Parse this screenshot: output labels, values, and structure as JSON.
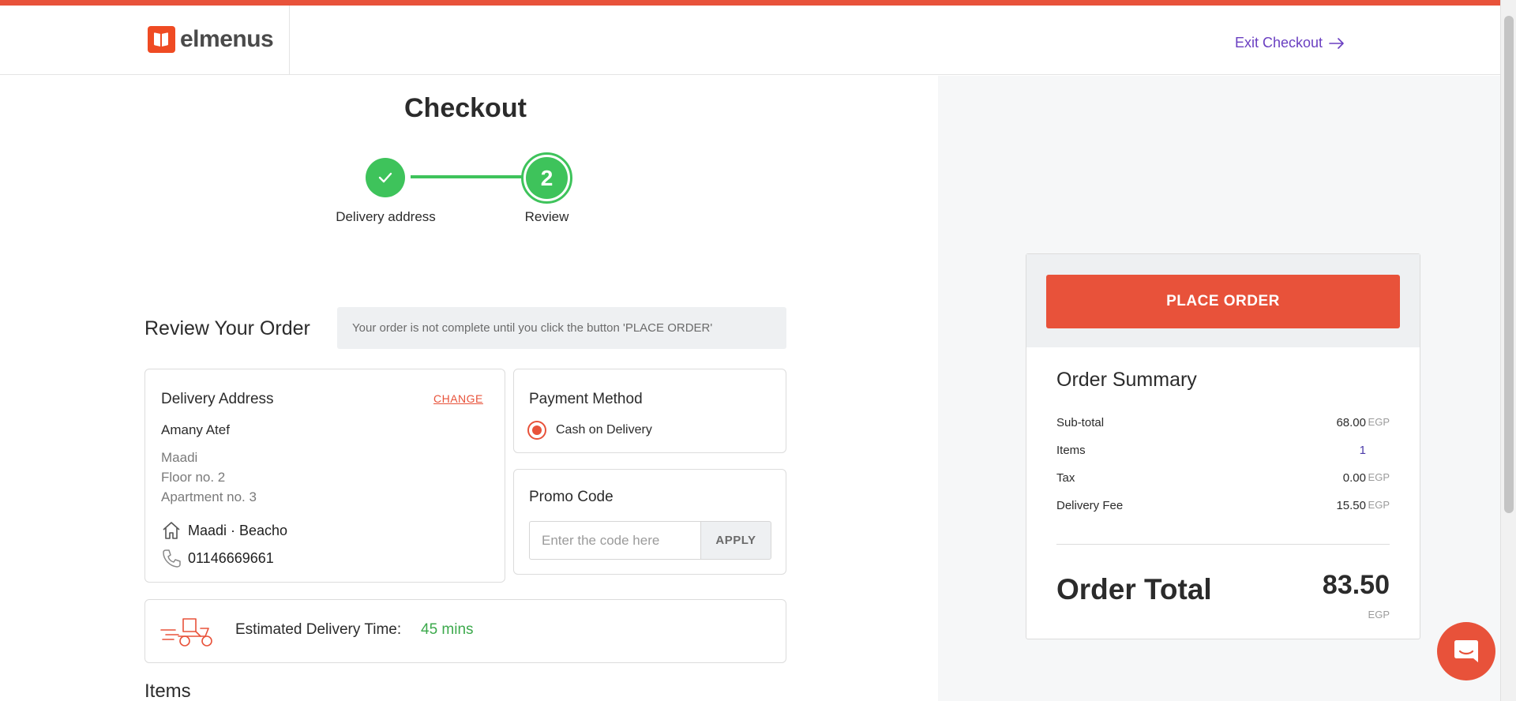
{
  "brand": {
    "name": "elmenus",
    "accent": "#e8523a",
    "success": "#3ec35b"
  },
  "header": {
    "exit_label": "Exit Checkout"
  },
  "checkout": {
    "title": "Checkout",
    "steps": [
      {
        "label": "Delivery address",
        "status": "completed"
      },
      {
        "label": "Review",
        "number": "2",
        "status": "current"
      }
    ]
  },
  "review": {
    "heading": "Review Your Order",
    "notice": "Your order is not complete until you click the button 'PLACE ORDER'"
  },
  "delivery_address": {
    "title": "Delivery Address",
    "change_label": "CHANGE",
    "name": "Amany Atef",
    "lines": [
      "Maadi",
      "Floor no. 2",
      "Apartment no. 3"
    ],
    "area": "Maadi · Beacho",
    "phone": "01146669661"
  },
  "payment": {
    "title": "Payment Method",
    "option": "Cash on Delivery"
  },
  "promo": {
    "title": "Promo Code",
    "placeholder": "Enter the code here",
    "apply_label": "APPLY"
  },
  "eta": {
    "label": "Estimated Delivery Time:",
    "value": "45 mins"
  },
  "items_heading": "Items",
  "summary": {
    "place_order_label": "PLACE ORDER",
    "title": "Order Summary",
    "subtotal_label": "Sub-total",
    "subtotal_value": "68.00",
    "items_label": "Items",
    "items_value": "1",
    "tax_label": "Tax",
    "tax_value": "0.00",
    "delivery_label": "Delivery Fee",
    "delivery_value": "15.50",
    "currency": "EGP",
    "total_label": "Order Total",
    "total_value": "83.50"
  },
  "icons": [
    "check-icon",
    "arrow-right-icon",
    "home-icon",
    "phone-icon",
    "delivery-scooter-icon",
    "chat-icon"
  ]
}
